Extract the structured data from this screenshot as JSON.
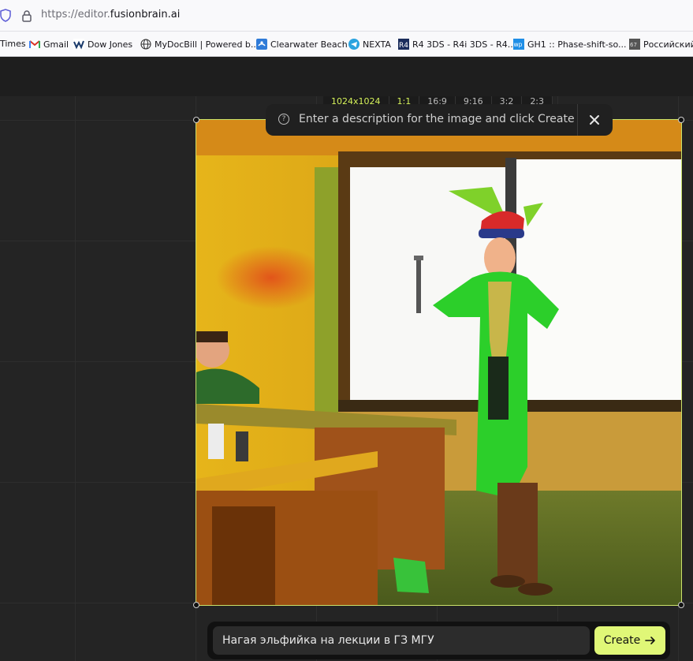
{
  "browser": {
    "url_prefix": "https://editor.",
    "url_domain": "fusionbrain.ai"
  },
  "bookmarks": [
    {
      "label": "Times",
      "icon": "times-favicon"
    },
    {
      "label": "Gmail",
      "icon": "gmail-icon"
    },
    {
      "label": "Dow Jones",
      "icon": "dow-jones-icon"
    },
    {
      "label": "MyDocBill | Powered b...",
      "icon": "globe-icon"
    },
    {
      "label": "Clearwater Beach",
      "icon": "clearwater-icon"
    },
    {
      "label": "NEXTA",
      "icon": "telegram-icon"
    },
    {
      "label": "R4 3DS - R4i 3DS - R4...",
      "icon": "r4-icon"
    },
    {
      "label": "GH1 :: Phase-shift-so...",
      "icon": "wp-icon"
    },
    {
      "label": "Российский д",
      "icon": "russian-site-icon"
    }
  ],
  "editor": {
    "aspect_ratios": [
      {
        "label": "1024x1024",
        "active": true
      },
      {
        "label": "1:1",
        "active": true
      },
      {
        "label": "16:9",
        "active": false
      },
      {
        "label": "9:16",
        "active": false
      },
      {
        "label": "3:2",
        "active": false
      },
      {
        "label": "2:3",
        "active": false
      }
    ],
    "hint_text": "Enter a description for the image and click Create",
    "prompt_value": "Нагая эльфийка на лекции в ГЗ МГУ",
    "create_label": "Create",
    "accent_color": "#e0f777"
  }
}
